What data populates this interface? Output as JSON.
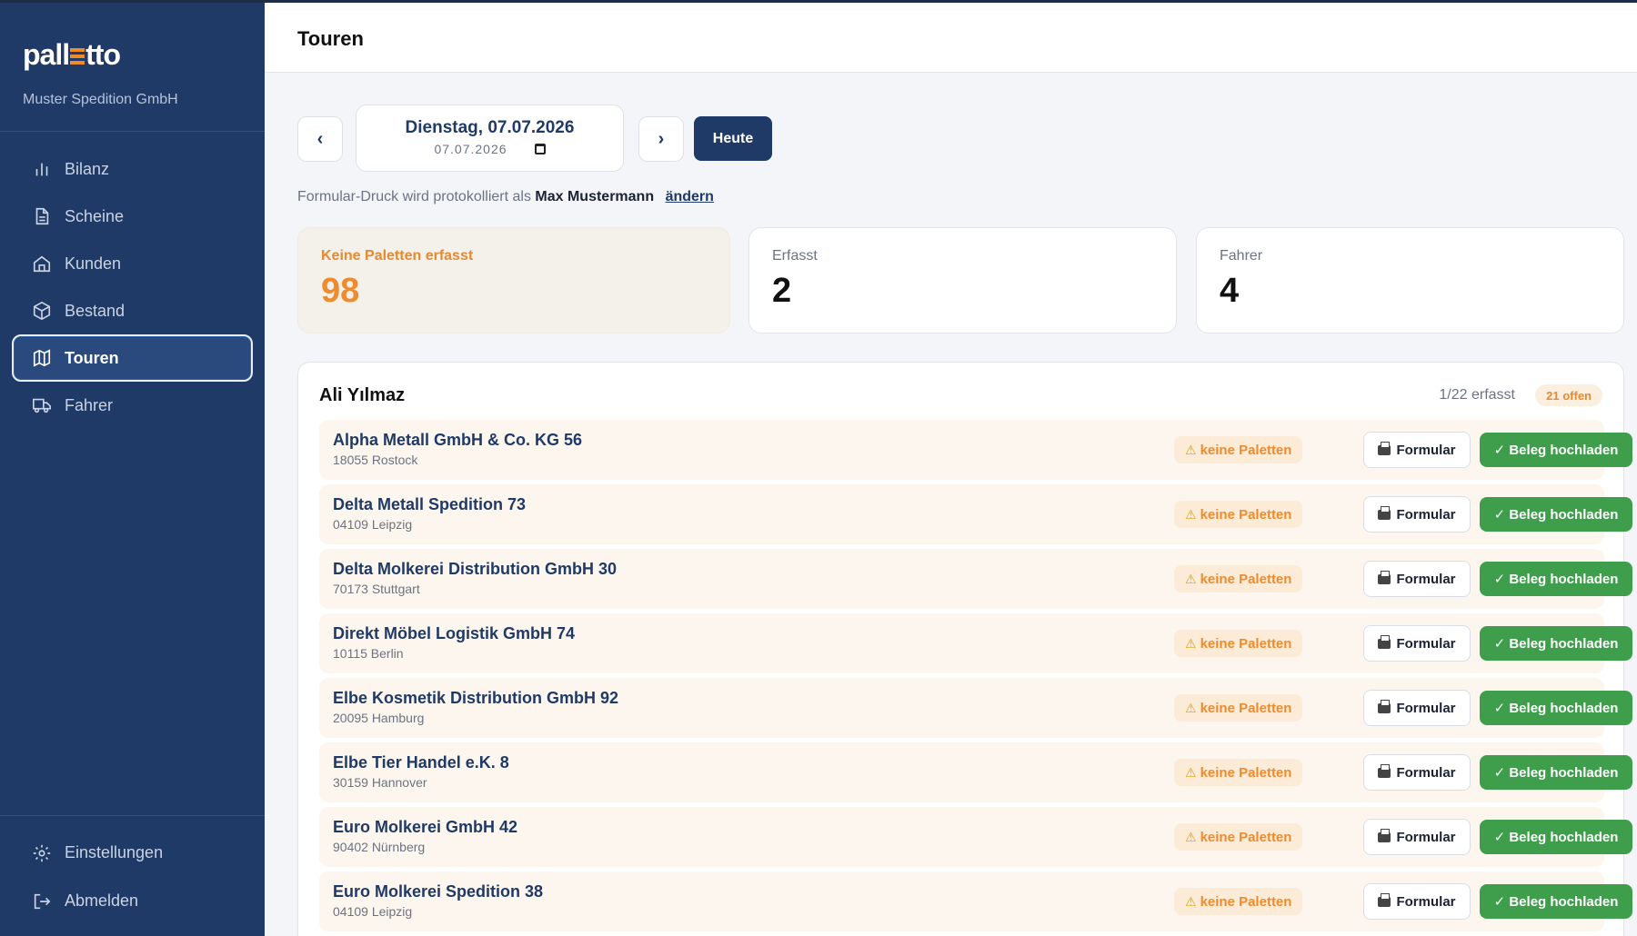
{
  "brand": {
    "logo_left": "pall",
    "logo_right": "tto",
    "company": "Muster Spedition GmbH"
  },
  "sidebar": {
    "items": [
      {
        "label": "Bilanz",
        "icon": "bar-chart-icon"
      },
      {
        "label": "Scheine",
        "icon": "document-icon"
      },
      {
        "label": "Kunden",
        "icon": "home-icon"
      },
      {
        "label": "Bestand",
        "icon": "box-icon"
      },
      {
        "label": "Touren",
        "icon": "map-icon",
        "active": true
      },
      {
        "label": "Fahrer",
        "icon": "truck-icon"
      }
    ],
    "settings": "Einstellungen",
    "logout": "Abmelden"
  },
  "header": {
    "title": "Touren"
  },
  "date": {
    "prev": "‹",
    "next": "›",
    "display": "Dienstag, 07.07.2026",
    "input_value": "07.07.2026",
    "today": "Heute"
  },
  "protocol": {
    "text": "Formular-Druck wird protokolliert als",
    "user": "Max Mustermann",
    "change": "ändern"
  },
  "stats": [
    {
      "label": "Keine Paletten erfasst",
      "value": "98"
    },
    {
      "label": "Erfasst",
      "value": "2"
    },
    {
      "label": "Fahrer",
      "value": "4"
    }
  ],
  "tour": {
    "driver": "Ali Yılmaz",
    "progress": "1/22 erfasst",
    "open": "21 offen",
    "chip_label": "keine Paletten",
    "form_label": "Formular",
    "upload_label": "✓ Beleg hochladen",
    "colors": {
      "accent": "#1f3a67",
      "warning": "#ef8b2c",
      "success": "#3e9e4c"
    },
    "rows": [
      {
        "name": "Alpha Metall GmbH & Co. KG 56",
        "city": "18055 Rostock"
      },
      {
        "name": "Delta Metall Spedition 73",
        "city": "04109 Leipzig"
      },
      {
        "name": "Delta Molkerei Distribution GmbH 30",
        "city": "70173 Stuttgart"
      },
      {
        "name": "Direkt Möbel Logistik GmbH 74",
        "city": "10115 Berlin"
      },
      {
        "name": "Elbe Kosmetik Distribution GmbH 92",
        "city": "20095 Hamburg"
      },
      {
        "name": "Elbe Tier Handel e.K. 8",
        "city": "30159 Hannover"
      },
      {
        "name": "Euro Molkerei GmbH 42",
        "city": "90402 Nürnberg"
      },
      {
        "name": "Euro Molkerei Spedition 38",
        "city": "04109 Leipzig"
      }
    ]
  }
}
